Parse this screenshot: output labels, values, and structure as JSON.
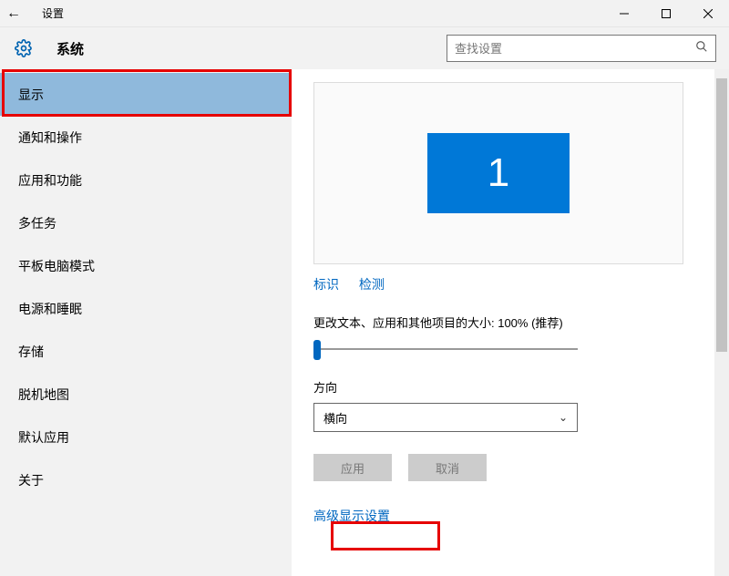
{
  "window": {
    "title": "设置"
  },
  "header": {
    "section": "系统",
    "searchPlaceholder": "查找设置"
  },
  "sidebar": {
    "items": [
      {
        "label": "显示",
        "selected": true
      },
      {
        "label": "通知和操作"
      },
      {
        "label": "应用和功能"
      },
      {
        "label": "多任务"
      },
      {
        "label": "平板电脑模式"
      },
      {
        "label": "电源和睡眠"
      },
      {
        "label": "存储"
      },
      {
        "label": "脱机地图"
      },
      {
        "label": "默认应用"
      },
      {
        "label": "关于"
      }
    ]
  },
  "content": {
    "monitorNumber": "1",
    "identifyLabel": "标识",
    "detectLabel": "检测",
    "scaleLabel": "更改文本、应用和其他项目的大小: 100% (推荐)",
    "orientationLabel": "方向",
    "orientationValue": "横向",
    "applyLabel": "应用",
    "cancelLabel": "取消",
    "advancedLink": "高级显示设置"
  }
}
